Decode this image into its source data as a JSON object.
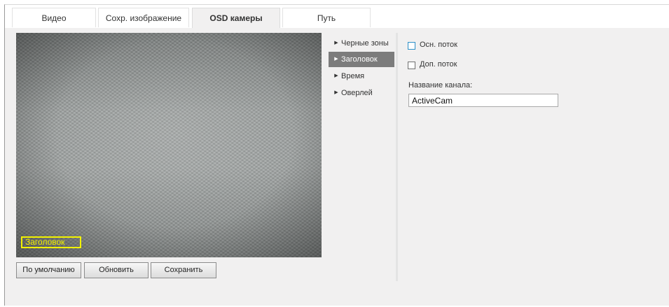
{
  "tabs": [
    {
      "label": "Видео"
    },
    {
      "label": "Сохр. изображение"
    },
    {
      "label": "OSD камеры",
      "active": true
    },
    {
      "label": "Путь"
    }
  ],
  "preview": {
    "osd_label": "Заголовок",
    "osd_color": "#f2f200"
  },
  "buttons": {
    "default_label": "По умолчанию",
    "refresh_label": "Обновить",
    "save_label": "Сохранить"
  },
  "submenu": {
    "items": [
      {
        "label": "Черные зоны",
        "icon": "triangle-right-icon"
      },
      {
        "label": "Заголовок",
        "icon": "triangle-right-icon",
        "active": true
      },
      {
        "label": "Время",
        "icon": "triangle-right-icon"
      },
      {
        "label": "Оверлей",
        "icon": "triangle-right-icon"
      }
    ]
  },
  "settings": {
    "main_stream_label": "Осн. поток",
    "main_stream_checked": false,
    "sub_stream_label": "Доп. поток",
    "sub_stream_checked": false,
    "channel_name_label": "Название канала:",
    "channel_name_value": "ActiveCam"
  },
  "colors": {
    "active_menu_bg": "#7c7c7c",
    "panel_bg": "#f1f0f0"
  }
}
